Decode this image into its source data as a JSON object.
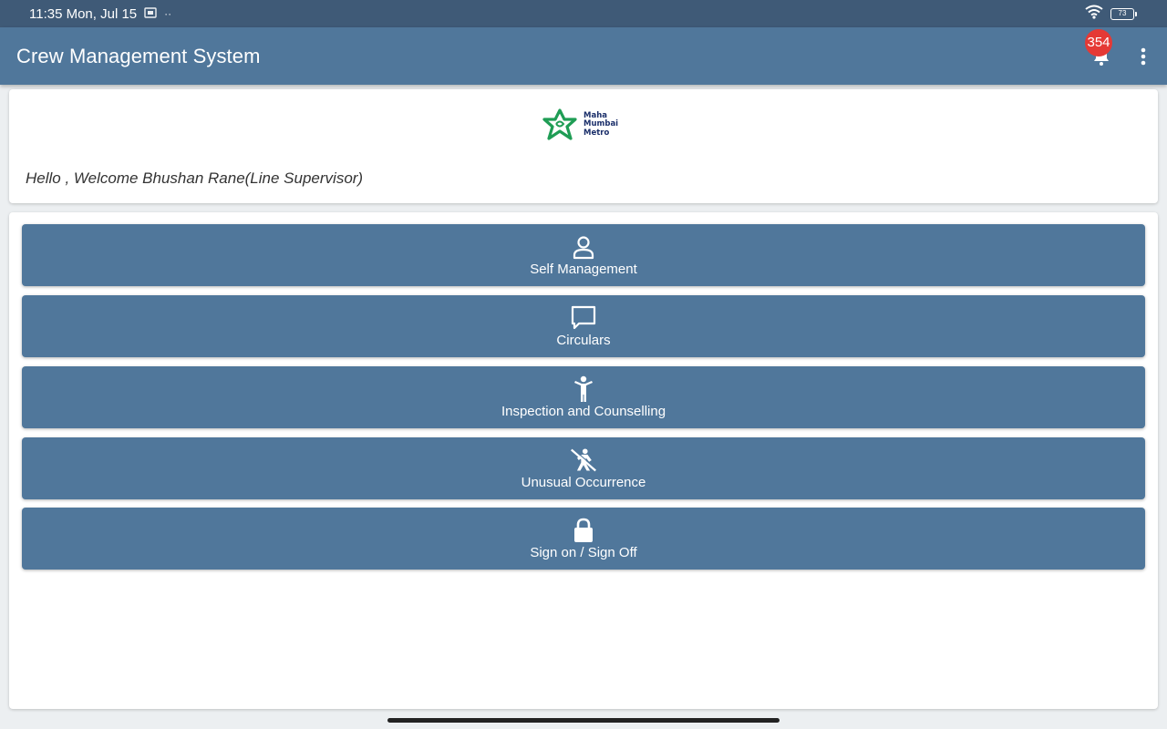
{
  "status_bar": {
    "time": "11:35 Mon, Jul 15",
    "dots": "··",
    "battery": "73"
  },
  "app_bar": {
    "title": "Crew Management System",
    "notification_count": "354"
  },
  "logo": {
    "line1": "Maha",
    "line2": "Mumbai",
    "line3": "Metro"
  },
  "welcome": {
    "text": "Hello , Welcome Bhushan Rane(Line Supervisor)"
  },
  "menu": [
    {
      "label": "Self Management",
      "icon": "person-icon"
    },
    {
      "label": "Circulars",
      "icon": "chat-bubble-icon"
    },
    {
      "label": "Inspection and Counselling",
      "icon": "child-figure-icon"
    },
    {
      "label": "Unusual Occurrence",
      "icon": "no-entry-figure-icon"
    },
    {
      "label": "Sign on / Sign Off",
      "icon": "lock-icon"
    }
  ],
  "colors": {
    "status_bar": "#3f5a77",
    "app_bar": "#50779b",
    "button": "#50779b",
    "badge": "#e53935",
    "logo_green": "#1f9d55",
    "logo_navy": "#1b2f6a"
  }
}
